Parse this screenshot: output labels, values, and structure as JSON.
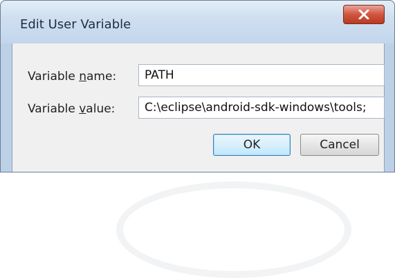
{
  "window": {
    "title": "Edit User Variable"
  },
  "close_icon": "close-icon",
  "fields": {
    "name": {
      "label_pre": "Variable ",
      "label_accel": "n",
      "label_post": "ame:",
      "value": "PATH"
    },
    "value": {
      "label_pre": "Variable ",
      "label_accel": "v",
      "label_post": "alue:",
      "value": "C:\\eclipse\\android-sdk-windows\\tools;"
    }
  },
  "buttons": {
    "ok": "OK",
    "cancel": "Cancel"
  },
  "colors": {
    "title_bar": "#c9dbef",
    "close_button": "#d0553f",
    "client_bg": "#f0f0f0",
    "default_button_border": "#3c7fb1"
  }
}
